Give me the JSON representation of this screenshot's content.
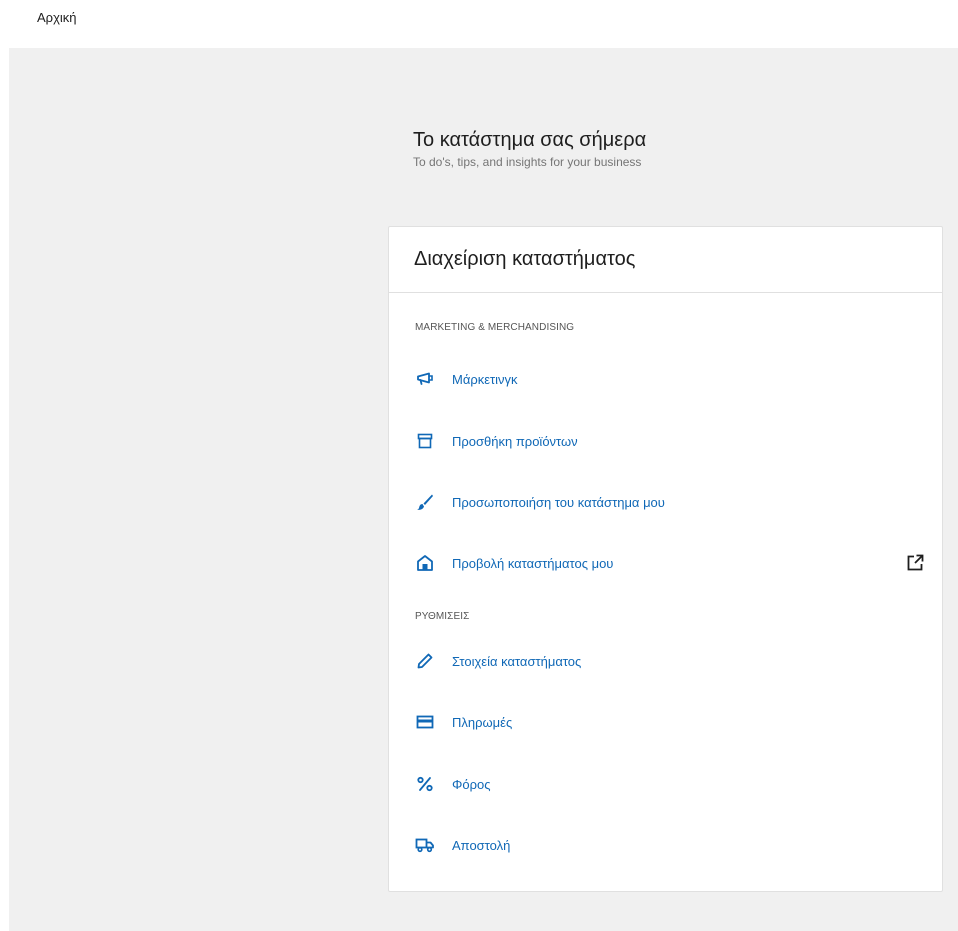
{
  "breadcrumb": "Αρχική",
  "header": {
    "title": "Το κατάστημα σας σήμερα",
    "subtitle": "To do's, tips, and insights for your business"
  },
  "card": {
    "title": "Διαχείριση καταστήματος",
    "sections": [
      {
        "label": "MARKETING & MERCHANDISING",
        "items": [
          {
            "label": "Μάρκετινγκ",
            "icon": "megaphone-icon"
          },
          {
            "label": "Προσθήκη προϊόντων",
            "icon": "archive-icon"
          },
          {
            "label": "Προσωποποιήση του κατάστημα μου",
            "icon": "brush-icon"
          },
          {
            "label": "Προβολή καταστήματος μου",
            "icon": "store-icon",
            "external": "external-link-icon"
          }
        ]
      },
      {
        "label": "ΡΥΘΜΙΣΕΙΣ",
        "items": [
          {
            "label": "Στοιχεία καταστήματος",
            "icon": "pencil-icon"
          },
          {
            "label": "Πληρωμές",
            "icon": "credit-card-icon"
          },
          {
            "label": "Φόρος",
            "icon": "percent-icon"
          },
          {
            "label": "Αποστολή",
            "icon": "truck-icon"
          }
        ]
      }
    ]
  },
  "colors": {
    "link": "#1068b6",
    "background": "#f0f0f0",
    "card": "#ffffff"
  }
}
